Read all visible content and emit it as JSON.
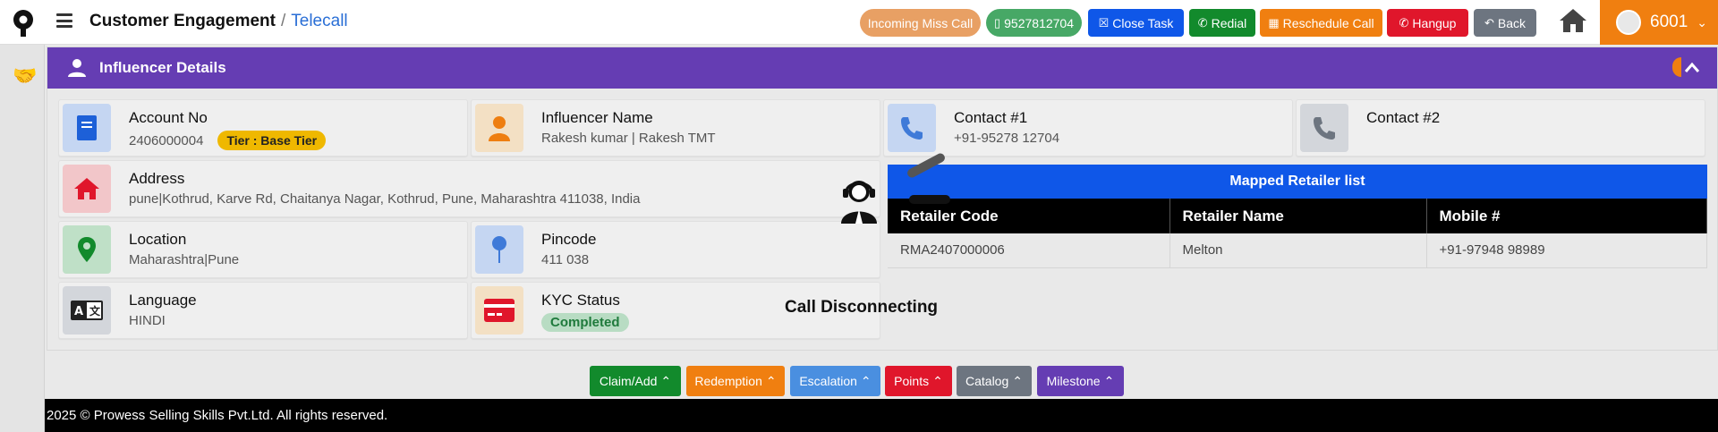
{
  "header": {
    "title": "Customer Engagement",
    "separator": "/",
    "subtitle": "Telecall",
    "buttons": [
      {
        "label": "Incoming Miss Call",
        "color": "#e8a064"
      },
      {
        "label": "9527812704",
        "color": "#47a866"
      },
      {
        "label": "Close Task",
        "color": "#0f57e8"
      },
      {
        "label": "Redial",
        "color": "#128a2c"
      },
      {
        "label": "Reschedule Call",
        "color": "#f07f10"
      },
      {
        "label": "Hangup",
        "color": "#e0162b"
      },
      {
        "label": "Back",
        "color": "#6d7580"
      }
    ],
    "user": "6001"
  },
  "panel": {
    "title": "Influencer Details",
    "header_color": "#653db3"
  },
  "cards": {
    "account": {
      "label": "Account No",
      "value": "2406000004",
      "tier": "Tier : Base Tier"
    },
    "influencer": {
      "label": "Influencer Name",
      "value": "Rakesh kumar | Rakesh TMT"
    },
    "contact1": {
      "label": "Contact #1",
      "value": "+91-95278 12704"
    },
    "contact2": {
      "label": "Contact #2",
      "value": ""
    },
    "address": {
      "label": "Address",
      "value": "pune|Kothrud, Karve Rd, Chaitanya Nagar, Kothrud, Pune, Maharashtra 411038, India"
    },
    "location": {
      "label": "Location",
      "value": "Maharashtra|Pune"
    },
    "pincode": {
      "label": "Pincode",
      "value": "411 038"
    },
    "language": {
      "label": "Language",
      "value": "HINDI"
    },
    "kyc": {
      "label": "KYC Status",
      "value": "Completed"
    }
  },
  "retailer": {
    "title": "Mapped Retailer list",
    "columns": [
      "Retailer Code",
      "Retailer Name",
      "Mobile #"
    ],
    "rows": [
      [
        "RMA2407000006",
        "Melton",
        "+91-97948 98989"
      ]
    ]
  },
  "call_status": "Call Disconnecting",
  "bottom_buttons": [
    {
      "label": "Claim/Add",
      "color": "#128a2c"
    },
    {
      "label": "Redemption",
      "color": "#f07f10"
    },
    {
      "label": "Escalation",
      "color": "#4a8fe0"
    },
    {
      "label": "Points",
      "color": "#e0162b"
    },
    {
      "label": "Catalog",
      "color": "#6d7580"
    },
    {
      "label": "Milestone",
      "color": "#653db3"
    }
  ],
  "footer": "2025 © Prowess Selling Skills Pvt.Ltd. All rights reserved."
}
